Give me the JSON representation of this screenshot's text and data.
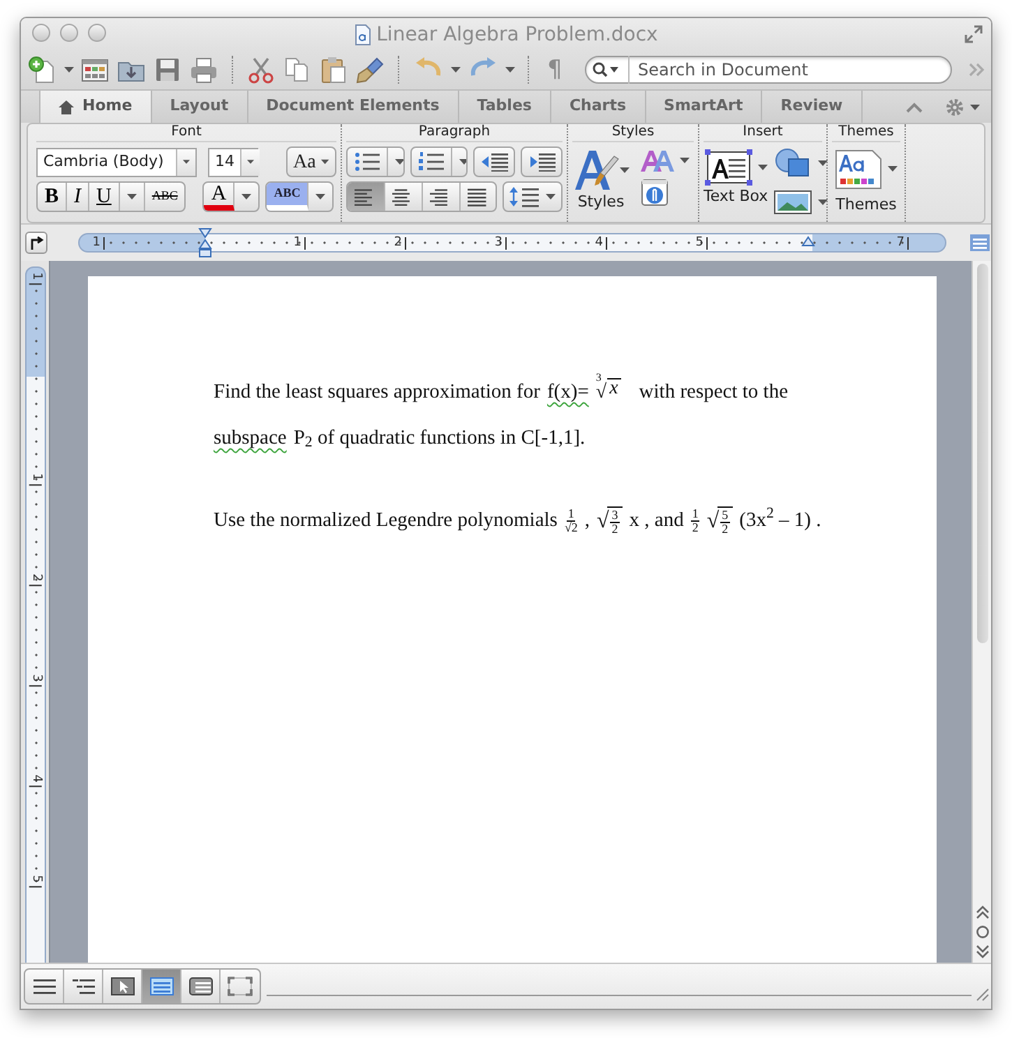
{
  "window": {
    "title": "Linear Algebra Problem.docx"
  },
  "toolbar": {
    "pilcrow": "¶",
    "search": {
      "placeholder": "Search in Document"
    }
  },
  "tabs": [
    {
      "label": "Home",
      "selected": true
    },
    {
      "label": "Layout",
      "selected": false
    },
    {
      "label": "Document Elements",
      "selected": false
    },
    {
      "label": "Tables",
      "selected": false
    },
    {
      "label": "Charts",
      "selected": false
    },
    {
      "label": "SmartArt",
      "selected": false
    },
    {
      "label": "Review",
      "selected": false
    }
  ],
  "ribbon": {
    "groups": [
      {
        "title": "Font"
      },
      {
        "title": "Paragraph"
      },
      {
        "title": "Styles"
      },
      {
        "title": "Insert"
      },
      {
        "title": "Themes"
      }
    ],
    "font": {
      "name": "Cambria (Body)",
      "size": "14",
      "grow": "Aa",
      "bold": "B",
      "italic": "I",
      "underline": "U",
      "strikethrough": "ABC",
      "font_color": "A",
      "highlight": "ABC"
    },
    "alignments": [
      {
        "selected": true
      },
      {
        "selected": false
      },
      {
        "selected": false
      },
      {
        "selected": false
      }
    ],
    "styles_label": "Styles",
    "text_box_label": "Text Box",
    "themes_label": "Themes"
  },
  "ruler": {
    "labels": [
      "1",
      "1",
      "2",
      "3",
      "4",
      "5",
      "7"
    ]
  },
  "vertical_ruler": {
    "labels": [
      "1",
      "1",
      "2",
      "3",
      "4",
      "5"
    ]
  },
  "document": {
    "paragraphs": [
      {
        "lines": [
          [
            {
              "kind": "text",
              "text": "Find the least squares approximation for",
              "flagged": false
            },
            {
              "kind": "text",
              "text": "f(x)=",
              "flagged": true
            },
            {
              "kind": "root",
              "radical": "√",
              "index": "3",
              "radicand": "x"
            },
            {
              "kind": "text",
              "text": "with respect to the",
              "flagged": false
            }
          ],
          [
            {
              "kind": "text",
              "text": "subspace",
              "flagged": true
            },
            {
              "kind": "text",
              "text": "P$_{2}$  of quadratic functions in C[-1,1].",
              "flagged": false
            }
          ]
        ]
      },
      {
        "lines": [
          [
            {
              "kind": "text",
              "text": "Use the normalized Legendre polynomials",
              "flagged": false
            },
            {
              "kind": "frac",
              "num": "1",
              "den": "√2"
            },
            {
              "kind": "text",
              "text": ",",
              "flagged": false
            },
            {
              "kind": "sqrtfrac",
              "radical": "√",
              "num": "3",
              "den": "2"
            },
            {
              "kind": "text",
              "text": "x , and",
              "flagged": false
            },
            {
              "kind": "frac",
              "num": "1",
              "den": "2"
            },
            {
              "kind": "sqrtfrac",
              "radical": "√",
              "num": "5",
              "den": "2"
            },
            {
              "kind": "text",
              "text": "(3x$^{2}$ – 1) .",
              "flagged": false
            }
          ]
        ]
      }
    ]
  },
  "view_buttons": [
    {
      "selected": false
    },
    {
      "selected": false
    },
    {
      "selected": false
    },
    {
      "selected": true
    },
    {
      "selected": false
    },
    {
      "selected": false
    }
  ]
}
